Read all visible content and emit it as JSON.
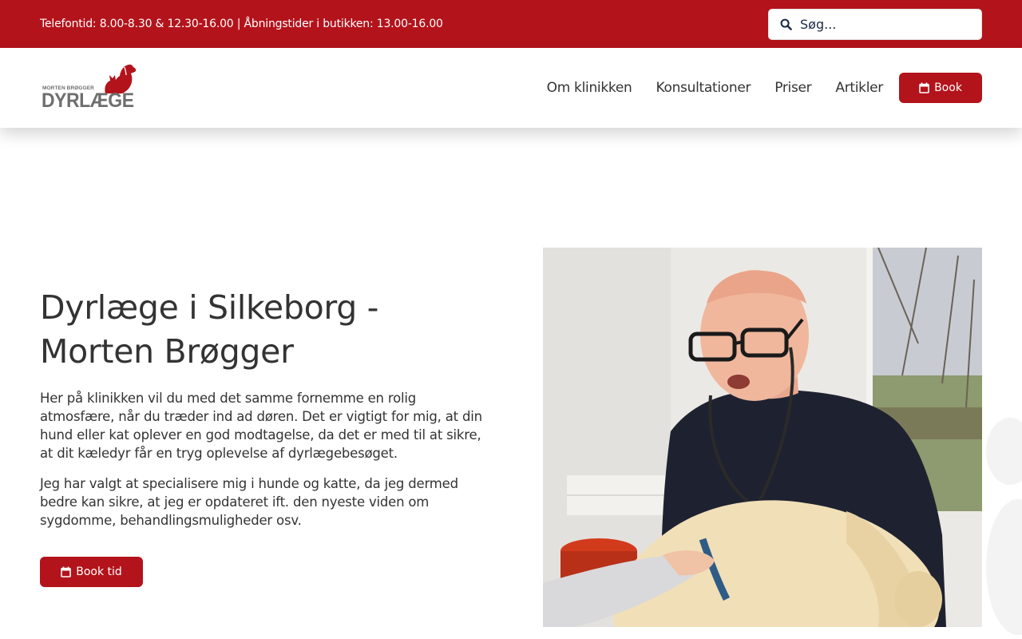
{
  "topbar": {
    "info": "Telefontid: 8.00-8.30 & 12.30-16.00 | Åbningstider i butikken: 13.00-16.00",
    "search_placeholder": "Søg...",
    "search_icon": "search-icon"
  },
  "logo": {
    "small_text": "MORTEN BRØGGER",
    "big_text": "DYRLÆGE"
  },
  "nav": {
    "items": [
      {
        "label": "Om klinikken"
      },
      {
        "label": "Konsultationer"
      },
      {
        "label": "Priser"
      },
      {
        "label": "Artikler"
      }
    ],
    "book_label": "Book",
    "book_icon": "calendar-icon"
  },
  "hero": {
    "title": "Dyrlæge i Silkeborg - Morten Brøgger",
    "paragraph_1": "Her på klinikken vil du med det samme fornemme en rolig atmosfære, når du træder ind ad døren. Det er vigtigt for mig, at din hund eller kat oplever en god modtagelse, da det er med til at sikre, at dit kæledyr får en tryg oplevelse af dyrlægebesøget.",
    "paragraph_2": "Jeg har valgt at specialisere mig i hunde og katte, da jeg dermed bedre kan sikre, at jeg er opdateret ift. den nyeste viden om sygdomme, behandlingsmuligheder osv.",
    "cta_label": "Book tid",
    "cta_icon": "calendar-icon"
  },
  "colors": {
    "brand_red": "#b3131b",
    "text": "#333333",
    "logo_grey": "#6e6e6e"
  }
}
